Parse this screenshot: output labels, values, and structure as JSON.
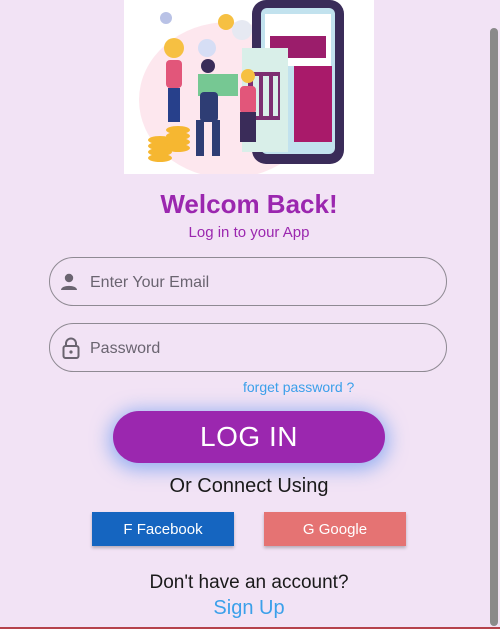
{
  "header": {
    "title": "Welcom Back!",
    "subtitle": "Log in to your App"
  },
  "form": {
    "email": {
      "placeholder": "Enter Your Email",
      "value": "",
      "icon": "person-icon"
    },
    "password": {
      "placeholder": "Password",
      "value": "",
      "icon": "lock-icon"
    },
    "forgot_label": "forget password ?",
    "login_label": "LOG IN"
  },
  "social": {
    "heading": "Or Connect Using",
    "facebook_label": "F Facebook",
    "google_label": "G Google"
  },
  "footer": {
    "prompt": "Don't have an account?",
    "signup_label": "Sign Up"
  },
  "colors": {
    "background": "#f2e3f5",
    "accent": "#9b27af",
    "link": "#3ba0ea",
    "facebook": "#1565c0",
    "google": "#e57373"
  }
}
